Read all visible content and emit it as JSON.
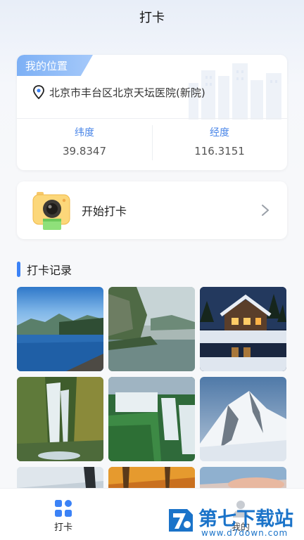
{
  "header": {
    "title": "打卡"
  },
  "location": {
    "tag": "我的位置",
    "address": "北京市丰台区北京天坛医院(新院)",
    "latitude_label": "纬度",
    "latitude_value": "39.8347",
    "longitude_label": "经度",
    "longitude_value": "116.3151"
  },
  "checkin": {
    "label": "开始打卡"
  },
  "records": {
    "title": "打卡记录",
    "photos": [
      "lake-mountains",
      "river-cliffs",
      "snow-cabin-night",
      "mossy-waterfall",
      "jungle-waterfalls",
      "snowy-peak",
      "cloudy-rock",
      "autumn-forest",
      "sunset-clouds"
    ]
  },
  "tabbar": {
    "items": [
      {
        "label": "打卡",
        "icon": "grid-icon",
        "active": true
      },
      {
        "label": "我的",
        "icon": "person-icon",
        "active": false
      }
    ]
  },
  "watermark": {
    "name": "第七下载站",
    "url": "www.d7down.com"
  },
  "colors": {
    "accent": "#3b82f6",
    "tag": "#7db0f5",
    "label_blue": "#4a86e8"
  }
}
